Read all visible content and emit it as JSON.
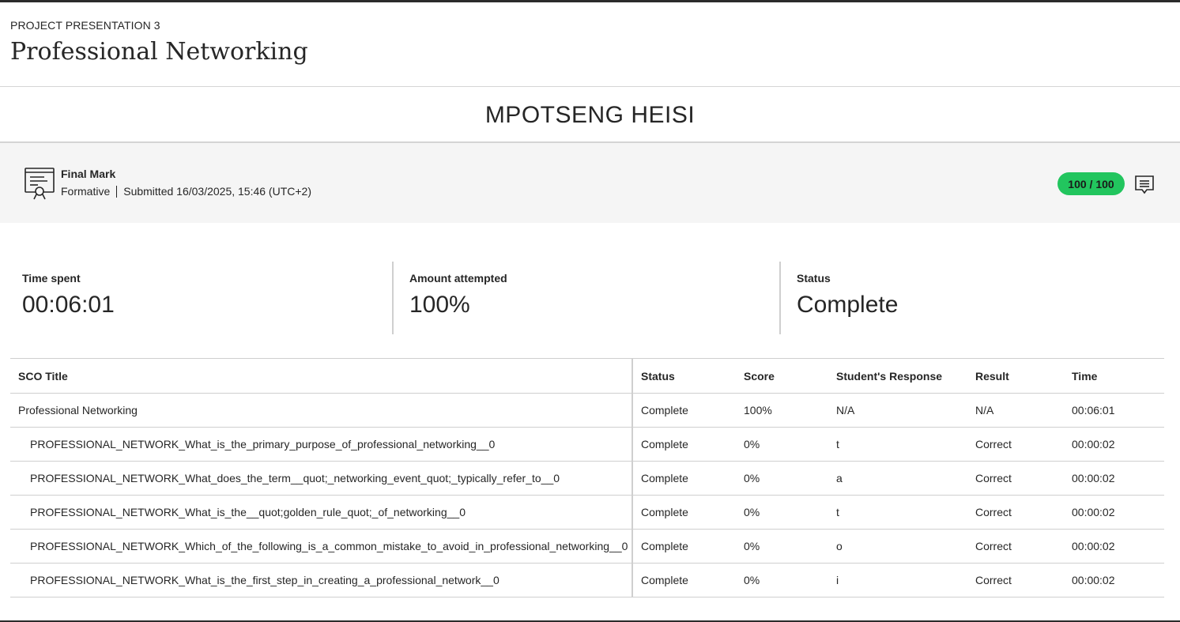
{
  "header": {
    "kicker": "PROJECT PRESENTATION 3",
    "title": "Professional Networking"
  },
  "student": {
    "name": "MPOTSENG HEISI"
  },
  "grade": {
    "label": "Final Mark",
    "type": "Formative",
    "submitted": "Submitted 16/03/2025, 15:46 (UTC+2)",
    "score": "100 / 100",
    "icon": "certificate-icon",
    "feedback_icon": "feedback-icon",
    "score_color": "#22c55e"
  },
  "stats": [
    {
      "label": "Time spent",
      "value": "00:06:01"
    },
    {
      "label": "Amount attempted",
      "value": "100%"
    },
    {
      "label": "Status",
      "value": "Complete"
    }
  ],
  "table": {
    "columns": [
      "SCO Title",
      "Status",
      "Score",
      "Student's Response",
      "Result",
      "Time"
    ],
    "rows": [
      {
        "title": "Professional Networking",
        "status": "Complete",
        "score": "100%",
        "response": "N/A",
        "result": "N/A",
        "time": "00:06:01",
        "child": false
      },
      {
        "title": "PROFESSIONAL_NETWORK_What_is_the_primary_purpose_of_professional_networking__0",
        "status": "Complete",
        "score": "0%",
        "response": "t",
        "result": "Correct",
        "time": "00:00:02",
        "child": true
      },
      {
        "title": "PROFESSIONAL_NETWORK_What_does_the_term__quot;_networking_event_quot;_typically_refer_to__0",
        "status": "Complete",
        "score": "0%",
        "response": "a",
        "result": "Correct",
        "time": "00:00:02",
        "child": true
      },
      {
        "title": "PROFESSIONAL_NETWORK_What_is_the__quot;golden_rule_quot;_of_networking__0",
        "status": "Complete",
        "score": "0%",
        "response": "t",
        "result": "Correct",
        "time": "00:00:02",
        "child": true
      },
      {
        "title": "PROFESSIONAL_NETWORK_Which_of_the_following_is_a_common_mistake_to_avoid_in_professional_networking__0",
        "status": "Complete",
        "score": "0%",
        "response": "o",
        "result": "Correct",
        "time": "00:00:02",
        "child": true
      },
      {
        "title": "PROFESSIONAL_NETWORK_What_is_the_first_step_in_creating_a_professional_network__0",
        "status": "Complete",
        "score": "0%",
        "response": "i",
        "result": "Correct",
        "time": "00:00:02",
        "child": true
      }
    ]
  }
}
